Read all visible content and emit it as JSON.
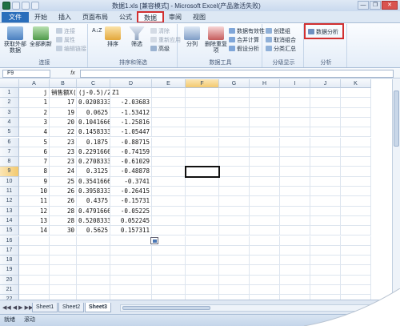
{
  "window": {
    "title": "数据1.xls [兼容模式] - Microsoft Excel(产品激活失败)",
    "controls": {
      "minimize": "—",
      "maximize": "❐",
      "close": "✕"
    }
  },
  "ribbon": {
    "tabs": [
      "文件",
      "开始",
      "插入",
      "页面布局",
      "公式",
      "数据",
      "审阅",
      "视图"
    ],
    "active_tab": "数据",
    "groups": {
      "connections": {
        "label": "连接",
        "get_external": "获取外部数据",
        "refresh_all": "全部刷新",
        "connections_btn": "连接",
        "properties": "属性",
        "edit_links": "编辑链接"
      },
      "sort_filter": {
        "label": "排序和筛选",
        "sort_az": "A↓Z",
        "sort": "排序",
        "filter": "筛选",
        "clear": "清除",
        "reapply": "重新应用",
        "advanced": "高级"
      },
      "data_tools": {
        "label": "数据工具",
        "text_to_columns": "分列",
        "remove_duplicates": "删除重复项",
        "data_validation": "数据有效性",
        "consolidate": "合并计算",
        "what_if": "假设分析"
      },
      "outline": {
        "label": "分级显示",
        "group": "创建组",
        "ungroup": "取消组合",
        "subtotal": "分类汇总"
      },
      "analysis": {
        "label": "分析",
        "data_analysis": "数据分析"
      }
    }
  },
  "formula_bar": {
    "name_box": "F9",
    "fx": "fx",
    "formula": ""
  },
  "sheet": {
    "columns": [
      "A",
      "B",
      "C",
      "D",
      "E",
      "F",
      "G",
      "H",
      "I",
      "J",
      "K"
    ],
    "selected_column": "F",
    "selected_row": 9,
    "rows": [
      [
        "j",
        "销售额X(j)",
        "(j-0.5)/24",
        "Z1"
      ],
      [
        "1",
        "17",
        "0.020833333",
        "-2.03683"
      ],
      [
        "2",
        "19",
        "0.0625",
        "-1.53412"
      ],
      [
        "3",
        "20",
        "0.104166667",
        "-1.25816"
      ],
      [
        "4",
        "22",
        "0.145833333",
        "-1.05447"
      ],
      [
        "5",
        "23",
        "0.1875",
        "-0.88715"
      ],
      [
        "6",
        "23",
        "0.229166667",
        "-0.74159"
      ],
      [
        "7",
        "23",
        "0.270833334",
        "-0.61029"
      ],
      [
        "8",
        "24",
        "0.3125",
        "-0.48878"
      ],
      [
        "9",
        "25",
        "0.354166667",
        "-0.3741"
      ],
      [
        "10",
        "26",
        "0.395833334",
        "-0.26415"
      ],
      [
        "11",
        "26",
        "0.4375",
        "-0.15731"
      ],
      [
        "12",
        "28",
        "0.479166667",
        "-0.05225"
      ],
      [
        "13",
        "28",
        "0.520833334",
        "0.052245"
      ],
      [
        "14",
        "30",
        "0.5625",
        "0.157311"
      ]
    ],
    "total_visible_rows": 22
  },
  "sheet_tabs": [
    "Sheet1",
    "Sheet2",
    "Sheet3"
  ],
  "active_sheet": "Sheet3",
  "status": {
    "mode": "就绪",
    "scroll": "滚动"
  },
  "colors": {
    "accent": "#2a6ebb",
    "highlight": "#d23030"
  }
}
